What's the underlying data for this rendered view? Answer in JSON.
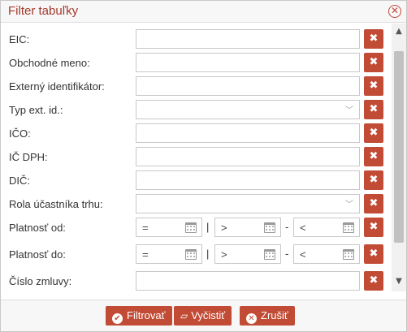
{
  "dialog": {
    "title": "Filter tabuľky",
    "close_icon": "close-circle-icon"
  },
  "fields": [
    {
      "label": "EIC:",
      "value": ""
    },
    {
      "label": "Obchodné meno:",
      "value": ""
    },
    {
      "label": "Externý identifikátor:",
      "value": ""
    },
    {
      "label": "Typ ext. id.:",
      "value": ""
    },
    {
      "label": "IČO:",
      "value": ""
    },
    {
      "label": "IČ DPH:",
      "value": ""
    },
    {
      "label": "DIČ:",
      "value": ""
    },
    {
      "label": "Rola účastníka trhu:",
      "value": ""
    },
    {
      "label": "Platnosť od:",
      "op1": "=",
      "sep1": "|",
      "op2": ">",
      "sep2": "-",
      "op3": "<"
    },
    {
      "label": "Platnosť do:",
      "op1": "=",
      "sep1": "|",
      "op2": ">",
      "sep2": "-",
      "op3": "<"
    },
    {
      "label": "Číslo zmluvy:",
      "value": ""
    }
  ],
  "clear_icon": "✖",
  "footer": {
    "filter_label": "Filtrovať",
    "clear_label": "Vyčistiť",
    "cancel_label": "Zrušiť"
  },
  "colors": {
    "accent": "#c24b35",
    "title": "#a23a2a"
  }
}
